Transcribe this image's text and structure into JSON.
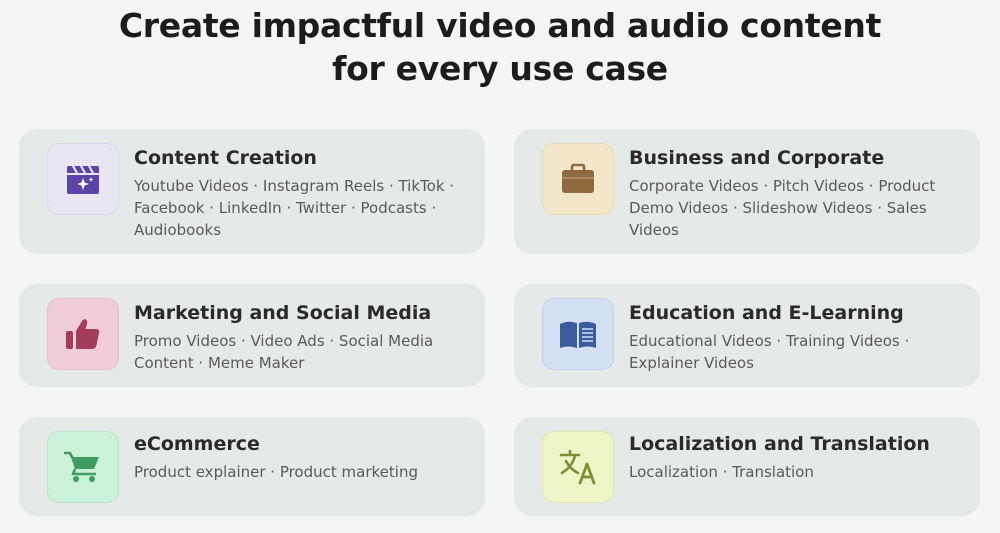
{
  "headline": {
    "line1": "Create impactful video and audio content",
    "line2": "for every use case"
  },
  "cards": [
    {
      "title": "Content Creation",
      "desc_lines": [
        "Youtube Videos · Instagram Reels · TikTok ·",
        "Facebook · LinkedIn · Twitter · Podcasts ·",
        "Audiobooks"
      ],
      "icon": "clapperboard-sparkle-icon",
      "icon_bg": "#e9e6f3",
      "icon_color": "#5a44a8"
    },
    {
      "title": "Business and Corporate",
      "desc_lines": [
        "Corporate Videos · Pitch Videos · Product",
        "Demo Videos · Slideshow Videos · Sales",
        "Videos"
      ],
      "icon": "briefcase-icon",
      "icon_bg": "#f4e6c8",
      "icon_color": "#8f6a3e"
    },
    {
      "title": "Marketing and Social Media",
      "desc_lines": [
        "Promo Videos · Video Ads · Social Media",
        "Content · Meme Maker"
      ],
      "icon": "thumbs-up-icon",
      "icon_bg": "#f0cdd8",
      "icon_color": "#a33d5c"
    },
    {
      "title": "Education and E-Learning",
      "desc_lines": [
        "Educational Videos · Training Videos ·",
        "Explainer Videos"
      ],
      "icon": "open-book-icon",
      "icon_bg": "#d3e0f4",
      "icon_color": "#3a5c9c"
    },
    {
      "title": "eCommerce",
      "desc_lines": [
        "Product explainer · Product marketing"
      ],
      "icon": "shopping-cart-icon",
      "icon_bg": "#caf2d6",
      "icon_color": "#3f9b60"
    },
    {
      "title": "Localization and Translation",
      "desc_lines": [
        "Localization · Translation"
      ],
      "icon": "translate-icon",
      "icon_bg": "#eff5c6",
      "icon_color": "#7f8d34"
    }
  ]
}
